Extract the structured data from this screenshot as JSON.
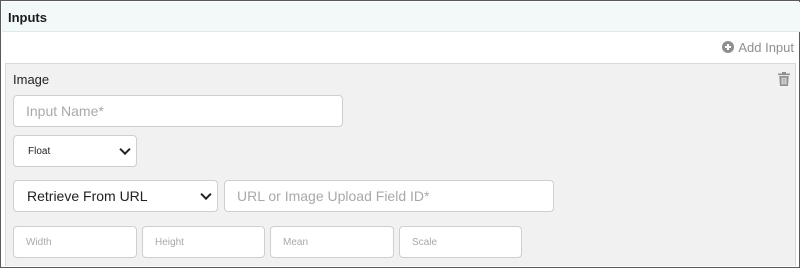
{
  "header": {
    "title": "Inputs"
  },
  "toolbar": {
    "add_input_label": "Add Input",
    "add_icon": "plus-circle-icon"
  },
  "panel": {
    "title": "Image",
    "delete_icon": "trash-icon",
    "input_name": {
      "value": "",
      "placeholder": "Input Name*"
    },
    "type_select": {
      "selected": "Float"
    },
    "source_select": {
      "selected": "Retrieve From URL"
    },
    "url_field": {
      "value": "",
      "placeholder": "URL or Image Upload Field ID*"
    },
    "dimensions": {
      "width": {
        "value": "",
        "placeholder": "Width"
      },
      "height": {
        "value": "",
        "placeholder": "Height"
      },
      "mean": {
        "value": "",
        "placeholder": "Mean"
      },
      "scale": {
        "value": "",
        "placeholder": "Scale"
      }
    }
  },
  "colors": {
    "header_bg": "#f3f8f9",
    "panel_bg": "#f1f1f1",
    "muted": "#8f8f8f"
  }
}
